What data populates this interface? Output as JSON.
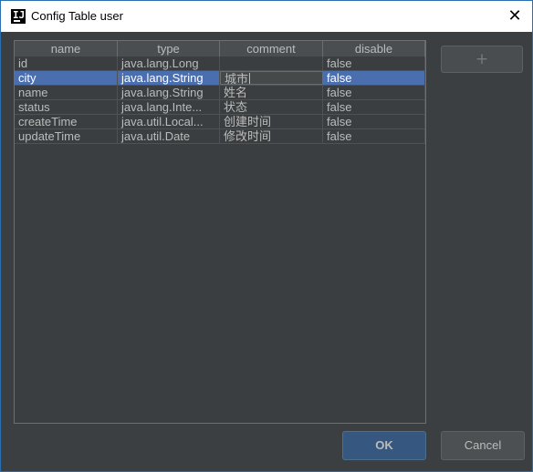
{
  "window": {
    "title": "Config Table user",
    "close_glyph": "✕"
  },
  "table": {
    "columns": [
      "name",
      "type",
      "comment",
      "disable"
    ],
    "rows": [
      {
        "name": "id",
        "type": "java.lang.Long",
        "comment": "",
        "disable": "false"
      },
      {
        "name": "city",
        "type": "java.lang.String",
        "comment": "城市",
        "disable": "false"
      },
      {
        "name": "name",
        "type": "java.lang.String",
        "comment": "姓名",
        "disable": "false"
      },
      {
        "name": "status",
        "type": "java.lang.Inte...",
        "comment": "状态",
        "disable": "false"
      },
      {
        "name": "createTime",
        "type": "java.util.Local...",
        "comment": "创建时间",
        "disable": "false"
      },
      {
        "name": "updateTime",
        "type": "java.util.Date",
        "comment": "修改时间",
        "disable": "false"
      }
    ],
    "selected_row": 1,
    "editing_cell": "comment"
  },
  "buttons": {
    "add_label": "+",
    "ok_label": "OK",
    "cancel_label": "Cancel"
  },
  "colors": {
    "background": "#3c3f41",
    "selection": "#4b6eaf",
    "ok_button": "#365880"
  },
  "icons": {
    "app_icon": "intellij-icon",
    "close_icon": "close-icon"
  }
}
